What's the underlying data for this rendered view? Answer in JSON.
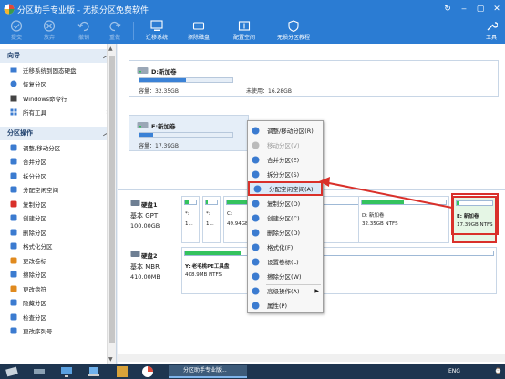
{
  "window": {
    "title": "分区助手专业版 - 无损分区免费软件",
    "controls": [
      "↻",
      "‒",
      "▢",
      "✕"
    ]
  },
  "toolbar": {
    "buttons": [
      {
        "label": "提交"
      },
      {
        "label": "放弃"
      },
      {
        "label": "撤销"
      },
      {
        "label": "重做"
      },
      {
        "label": "迁移系统"
      },
      {
        "label": "擦除磁盘"
      },
      {
        "label": "配置空间"
      },
      {
        "label": "无损分区教程"
      },
      {
        "label": "工具"
      }
    ]
  },
  "sidebar": {
    "wizard": {
      "title": "向导",
      "items": [
        "迁移系统到固态硬盘",
        "恢复分区",
        "Windows命令行",
        "所有工具"
      ]
    },
    "ops": {
      "title": "分区操作",
      "items": [
        "调整/移动分区",
        "合并分区",
        "拆分分区",
        "分配空闲空间",
        "复制分区",
        "创建分区",
        "删除分区",
        "格式化分区",
        "更改卷标",
        "擦除分区",
        "更改盘符",
        "隐藏分区",
        "检查分区",
        "更改序列号"
      ]
    }
  },
  "cards": {
    "d": {
      "name": "D:新加卷",
      "capacity": "容量：32.35GB",
      "unused": "未使用：16.28GB",
      "fill": 0.5
    },
    "e": {
      "name": "E:新加卷",
      "capacity": "容量：17.39GB",
      "fill": 0.15
    }
  },
  "disks": [
    {
      "name": "硬盘1",
      "type": "基本 GPT",
      "size": "100.00GB",
      "parts": [
        {
          "l1": "*:",
          "l2": "1...",
          "fill": 0.3
        },
        {
          "l1": "*:",
          "l2": "1...",
          "fill": 0.2
        },
        {
          "l1": "C:",
          "l2": "49.94GB",
          "fill": 0.45
        },
        {
          "l1": "D: 新加卷",
          "l2": "32.35GB NTFS",
          "fill": 0.5
        },
        {
          "l1": "E: 新加卷",
          "l2": "17.39GB NTFS",
          "fill": 0.08
        }
      ]
    },
    {
      "name": "硬盘2",
      "type": "基本 MBR",
      "size": "410.00MB",
      "parts": [
        {
          "l1": "Y: 老毛桃PE工具盘",
          "l2": "408.9MB NTFS",
          "fill": 0.18
        }
      ]
    }
  ],
  "context_menu": {
    "items": [
      {
        "label": "调整/移动分区(R)",
        "disabled": false
      },
      {
        "label": "移动分区(V)",
        "disabled": true
      },
      {
        "label": "合并分区(E)",
        "disabled": false
      },
      {
        "label": "拆分分区(S)",
        "disabled": false
      },
      {
        "label": "分配空闲空间(A)",
        "disabled": false,
        "highlighted": true
      },
      {
        "label": "复制分区(O)",
        "disabled": false
      },
      {
        "label": "创建分区(C)",
        "disabled": false
      },
      {
        "label": "删除分区(D)",
        "disabled": false
      },
      {
        "label": "格式化(F)",
        "disabled": false
      },
      {
        "label": "设置卷标(L)",
        "disabled": false
      },
      {
        "label": "擦除分区(W)",
        "disabled": false
      },
      {
        "label": "高级操作(A)",
        "disabled": false,
        "submenu": true
      },
      {
        "label": "属性(P)",
        "disabled": false
      }
    ]
  },
  "taskbar": {
    "task_label": "分区助手专业版...",
    "lang": "ENG",
    "clock": "⌚"
  },
  "colors": {
    "accent": "#2b7cd3",
    "highlight_box": "#d9302a",
    "used": "#3b82d6",
    "partition": "#34c35e"
  }
}
